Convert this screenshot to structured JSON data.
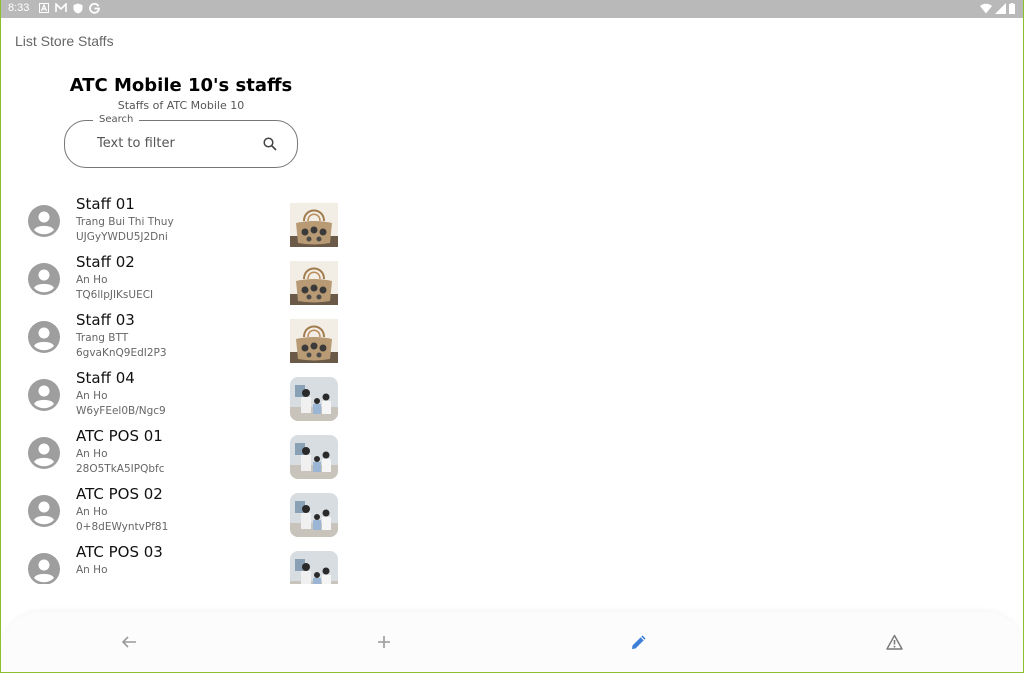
{
  "status_bar": {
    "time": "8:33",
    "notification_icons": [
      "a-icon",
      "m-icon",
      "shield-icon",
      "g-icon"
    ],
    "system_icons": [
      "wifi-icon",
      "signal-icon",
      "battery-icon"
    ]
  },
  "app": {
    "title": "List Store Staffs"
  },
  "header": {
    "title": "ATC Mobile 10's staffs",
    "subtitle": "Staffs of ATC Mobile 10"
  },
  "search": {
    "label": "Search",
    "placeholder": "Text to filter",
    "value": ""
  },
  "staffs": [
    {
      "name": "Staff 01",
      "full_name": "Trang Bui Thi Thuy",
      "code": "UJGyYWDU5J2Dni",
      "photo": "handbag-photo"
    },
    {
      "name": "Staff 02",
      "full_name": "An Ho",
      "code": "TQ6llpJIKsUECI",
      "photo": "handbag-photo"
    },
    {
      "name": "Staff 03",
      "full_name": "Trang BTT",
      "code": "6gvaKnQ9EdI2P3",
      "photo": "handbag-photo"
    },
    {
      "name": "Staff 04",
      "full_name": "An Ho",
      "code": "W6yFEel0B/Ngc9",
      "photo": "family-photo"
    },
    {
      "name": "ATC POS 01",
      "full_name": "An Ho",
      "code": "28O5TkA5IPQbfc",
      "photo": "family-photo"
    },
    {
      "name": "ATC POS 02",
      "full_name": "An Ho",
      "code": "0+8dEWyntvPf81",
      "photo": "family-photo"
    },
    {
      "name": "ATC POS 03",
      "full_name": "An Ho",
      "code": "",
      "photo": "family-photo"
    }
  ],
  "bottom_nav": {
    "items": [
      {
        "icon": "back-arrow-icon",
        "active": false
      },
      {
        "icon": "plus-icon",
        "active": false
      },
      {
        "icon": "pencil-icon",
        "active": true
      },
      {
        "icon": "warning-icon",
        "active": false
      }
    ],
    "active_color": "#3d7fd6",
    "inactive_color": "#9a9a9a"
  },
  "colors": {
    "frame_border": "#8dbf2e",
    "status_bar": "#b9b9b9"
  }
}
